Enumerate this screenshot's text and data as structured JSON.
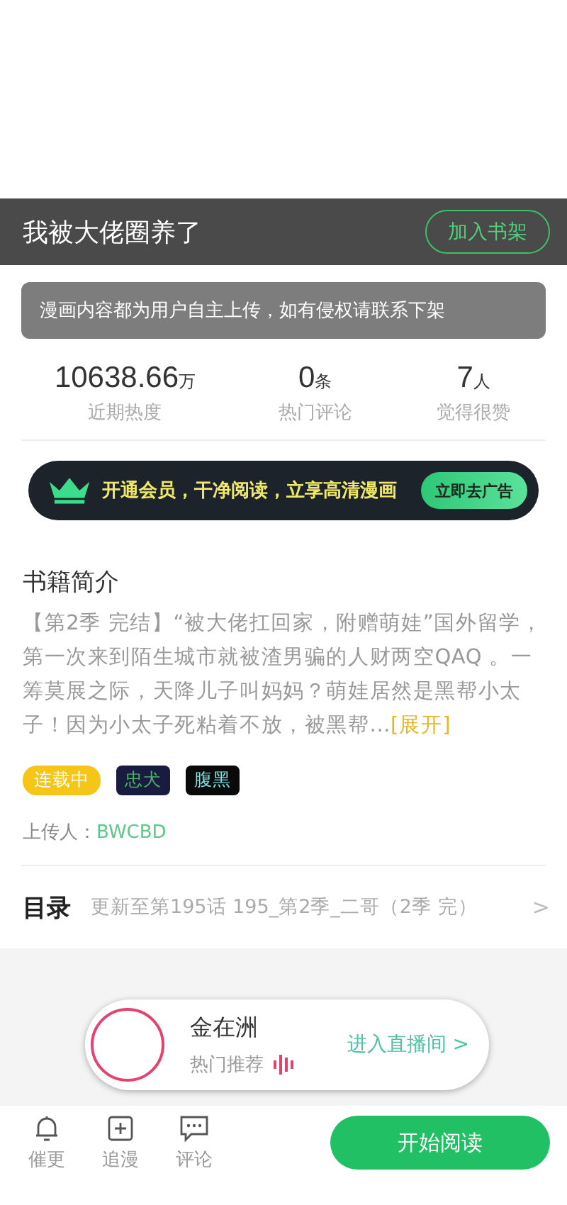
{
  "header": {
    "title": "我被大佬圈养了",
    "shelf_button": "加入书架"
  },
  "notice": "漫画内容都为用户自主上传，如有侵权请联系下架",
  "stats": [
    {
      "value": "10638.66",
      "unit": "万",
      "label": "近期热度"
    },
    {
      "value": "0",
      "unit": "条",
      "label": "热门评论"
    },
    {
      "value": "7",
      "unit": "人",
      "label": "觉得很赞"
    }
  ],
  "vip_banner": {
    "text": "开通会员，干净阅读，立享高清漫画",
    "button": "立即去广告"
  },
  "intro": {
    "title": "书籍简介",
    "text": "【第2季 完结】“被大佬扛回家，附赠萌娃”国外留学，第一次来到陌生城市就被渣男骗的人财两空QAQ 。一筹莫展之际，天降儿子叫妈妈？萌娃居然是黑帮小太子！因为小太子死粘着不放，被黑帮...",
    "expand": "[展开]"
  },
  "tags": [
    {
      "label": "连载中",
      "kind": "status"
    },
    {
      "label": "忠犬",
      "kind": "dark"
    },
    {
      "label": "腹黑",
      "kind": "black"
    }
  ],
  "uploader": {
    "label": "上传人：",
    "name": "BWCBD"
  },
  "catalog": {
    "title": "目录",
    "latest": "更新至第195话 195_第2季_二哥（2季 完）",
    "chevron": ">"
  },
  "live": {
    "name": "金在洲",
    "subtitle": "热门推荐",
    "enter": "进入直播间 >"
  },
  "bottom_bar": {
    "actions": [
      {
        "label": "催更",
        "kind": "bell"
      },
      {
        "label": "追漫",
        "kind": "plus"
      },
      {
        "label": "评论",
        "kind": "chat"
      }
    ],
    "read_button": "开始阅读"
  }
}
